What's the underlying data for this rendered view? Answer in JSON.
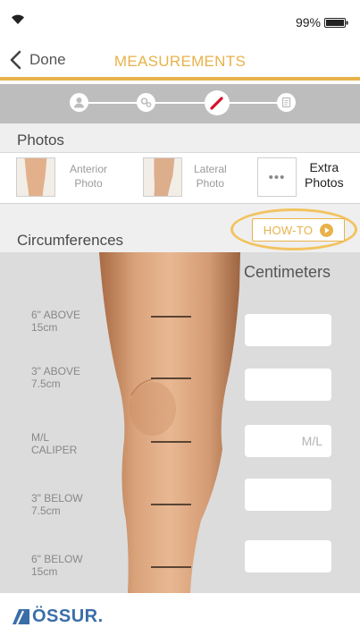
{
  "status_bar": {
    "battery_percent": "99%",
    "battery_level": 0.99
  },
  "nav": {
    "back_label": "Done",
    "title": "MEASUREMENTS",
    "accent_color": "#e8b24b"
  },
  "stepper": {
    "steps": [
      {
        "icon": "person-icon",
        "active": false
      },
      {
        "icon": "gears-icon",
        "active": false
      },
      {
        "icon": "pencil-icon",
        "active": true
      },
      {
        "icon": "document-icon",
        "active": false
      }
    ]
  },
  "photos": {
    "section_title": "Photos",
    "tiles": [
      {
        "label": "Anterior\nPhoto"
      },
      {
        "label": "Lateral\nPhoto"
      }
    ],
    "extra": {
      "dots": "•••",
      "label": "Extra\nPhotos"
    }
  },
  "circumferences": {
    "section_title": "Circumferences",
    "howto_label": "HOW-TO",
    "units_label": "Centimeters",
    "rows": [
      {
        "label": "6\" ABOVE\n15cm",
        "value": "",
        "placeholder": ""
      },
      {
        "label": "3\" ABOVE\n7.5cm",
        "value": "",
        "placeholder": ""
      },
      {
        "label": "M/L\nCALIPER",
        "value": "",
        "placeholder": "M/L"
      },
      {
        "label": "3\" BELOW\n7.5cm",
        "value": "",
        "placeholder": ""
      },
      {
        "label": "6\" BELOW\n15cm",
        "value": "",
        "placeholder": ""
      }
    ]
  },
  "footer": {
    "brand": "ÖSSUR.",
    "brand_color": "#3a6ea8"
  }
}
